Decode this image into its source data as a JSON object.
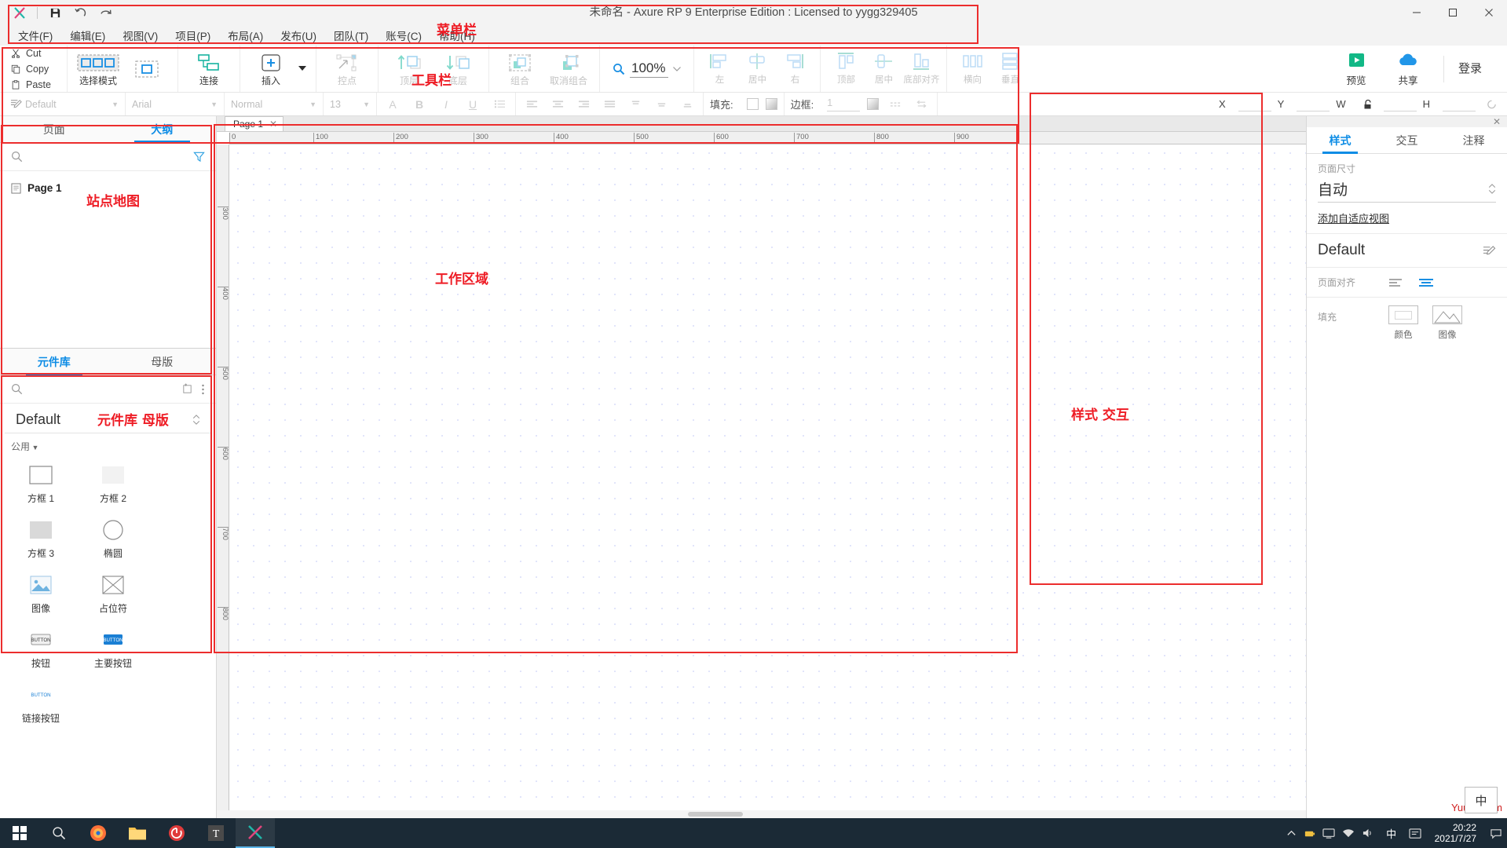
{
  "window": {
    "title": "未命名 - Axure RP 9 Enterprise Edition : Licensed to yygg329405",
    "minimize": "—",
    "maximize": "▢",
    "close": "✕"
  },
  "menubar": {
    "items": [
      {
        "text": "文件(F)",
        "key": "F"
      },
      {
        "text": "编辑(E)",
        "key": "E"
      },
      {
        "text": "视图(V)",
        "key": "V"
      },
      {
        "text": "项目(P)",
        "key": "P"
      },
      {
        "text": "布局(A)",
        "key": "A"
      },
      {
        "text": "发布(U)",
        "key": "U"
      },
      {
        "text": "团队(T)",
        "key": "T"
      },
      {
        "text": "账号(C)",
        "key": "C"
      },
      {
        "text": "帮助(H)",
        "key": "H"
      }
    ]
  },
  "toolbar": {
    "clipboard": [
      "Cut",
      "Copy",
      "Paste"
    ],
    "tools": [
      {
        "label": "选择模式",
        "enabled": true
      },
      {
        "label": "连接",
        "enabled": true
      },
      {
        "label": "插入",
        "enabled": true
      },
      {
        "label": "控点",
        "enabled": false
      },
      {
        "label": "顶层",
        "enabled": false
      },
      {
        "label": "底层",
        "enabled": false
      },
      {
        "label": "组合",
        "enabled": false
      },
      {
        "label": "取消组合",
        "enabled": false
      }
    ],
    "zoom": "100%",
    "align": [
      "左",
      "居中",
      "右",
      "顶部",
      "居中",
      "底部对齐",
      "横向",
      "垂直"
    ],
    "preview": "预览",
    "share": "共享",
    "login": "登录"
  },
  "formatbar": {
    "style": "Default",
    "font": "Arial",
    "weight": "Normal",
    "size": "13",
    "fill_label": "填充:",
    "border_label": "边框:",
    "border_width": "1",
    "coords": {
      "x": "X",
      "y": "Y",
      "w": "W",
      "h": "H"
    }
  },
  "left_panel": {
    "pages": {
      "tabs": [
        {
          "label": "页面",
          "active": false
        },
        {
          "label": "大纲",
          "active": true
        }
      ],
      "search_placeholder": "",
      "tree": [
        {
          "label": "Page 1"
        }
      ]
    },
    "libraries": {
      "tabs": [
        {
          "label": "元件库",
          "active": true
        },
        {
          "label": "母版",
          "active": false
        }
      ],
      "selected_library": "Default",
      "group": "公用",
      "widgets": [
        {
          "label": "方框 1",
          "icon": "rect-outline"
        },
        {
          "label": "方框 2",
          "icon": "rect-light"
        },
        {
          "label": "方框 3",
          "icon": "rect-gray"
        },
        {
          "label": "椭圆",
          "icon": "ellipse"
        },
        {
          "label": "图像",
          "icon": "image"
        },
        {
          "label": "占位符",
          "icon": "placeholder"
        },
        {
          "label": "按钮",
          "icon": "button"
        },
        {
          "label": "主要按钮",
          "icon": "primary-button"
        },
        {
          "label": "链接按钮",
          "icon": "link-button"
        }
      ]
    }
  },
  "canvas": {
    "tab": "Page 1",
    "tab_close": "✕",
    "ruler_h": [
      "0",
      "100",
      "200",
      "300",
      "400",
      "500",
      "600",
      "700",
      "800",
      "900"
    ],
    "ruler_v": [
      "300",
      "400",
      "500",
      "600",
      "700",
      "800"
    ]
  },
  "right_panel": {
    "close": "✕",
    "tabs": [
      {
        "label": "样式",
        "active": true
      },
      {
        "label": "交互",
        "active": false
      },
      {
        "label": "注释",
        "active": false
      }
    ],
    "page_size_label": "页面尺寸",
    "page_size_value": "自动",
    "adaptive_link": "添加自适应视图",
    "style_name": "Default",
    "page_align_label": "页面对齐",
    "fill_label": "填充",
    "fill_options": [
      {
        "label": "颜色",
        "icon": "color-swatch"
      },
      {
        "label": "图像",
        "icon": "image-swatch"
      }
    ]
  },
  "annotations": {
    "menu": "菜单栏",
    "toolbar": "工具栏",
    "sitemap": "站点地图",
    "libraries": "元件库 母版",
    "workspace": "工作区域",
    "style": "样式 交互",
    "color": "#ee1c25"
  },
  "taskbar": {
    "start": "⊞",
    "apps": [
      "search-icon",
      "firefox-icon",
      "explorer-icon",
      "recorder-icon",
      "typora-icon",
      "axure-icon"
    ],
    "ime": "中",
    "time": "20:22",
    "date": "2021/7/27",
    "watermark": "Yuuen.com",
    "ime_popup": "中"
  }
}
